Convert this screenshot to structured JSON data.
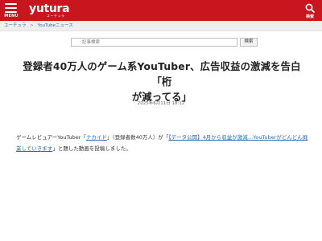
{
  "header": {
    "menu_label": "MENU",
    "logo_text": "yutura",
    "logo_sub": "ユーチュラ",
    "search_label": "検索",
    "brand_color": "#c9151e"
  },
  "breadcrumb": {
    "home": "ユーチュラ",
    "separator": ">",
    "current": "YouTubeニュース"
  },
  "search": {
    "placeholder": "記事検索",
    "button_label": "検索"
  },
  "article": {
    "title_line1": "登録者40万人のゲーム系YouTuber、広告収益の激減を告白「桁",
    "title_line2": "が減ってる」",
    "date": "2025年6月11日 18:12",
    "body_text_1": "ゲームレビュアーYouTuber「",
    "body_channel_link": "ナカイド",
    "body_text_2": "」（登録者数40万人）が「",
    "body_video_link": "【データ公開】4月から収益が激減…YouTuberがどんどん廃業していきます",
    "body_text_3": "」と題した動画を投稿しました。"
  },
  "icons": {
    "menu": "hamburger-menu-icon",
    "search": "magnifier-icon"
  }
}
